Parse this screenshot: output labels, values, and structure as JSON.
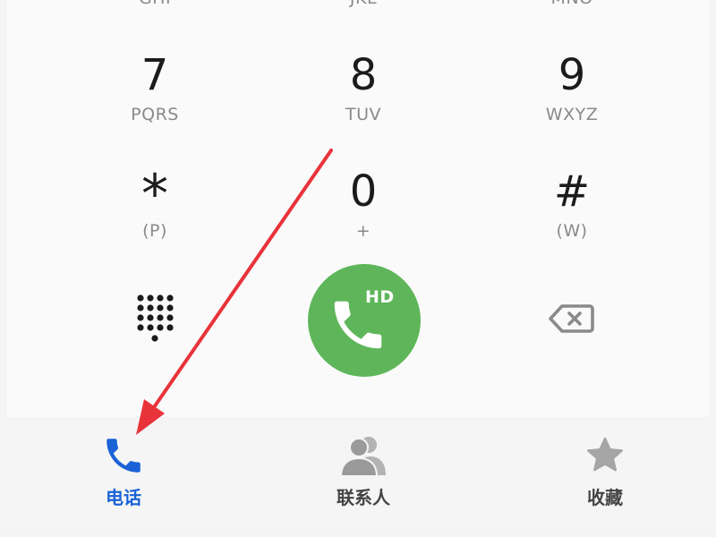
{
  "keypad": {
    "partial_row": [
      "GHI",
      "JKL",
      "MNO"
    ],
    "keys": [
      {
        "digit": "7",
        "sub": "PQRS"
      },
      {
        "digit": "8",
        "sub": "TUV"
      },
      {
        "digit": "9",
        "sub": "WXYZ"
      },
      {
        "digit": "*",
        "sub": "(P)"
      },
      {
        "digit": "0",
        "sub": "+"
      },
      {
        "digit": "#",
        "sub": "(W)"
      }
    ]
  },
  "actions": {
    "call_badge": "HD",
    "icons": [
      "dialpad-icon",
      "phone-icon",
      "backspace-icon"
    ]
  },
  "tabs": [
    {
      "label": "电话",
      "icon": "phone-icon",
      "active": true
    },
    {
      "label": "联系人",
      "icon": "contacts-icon",
      "active": false
    },
    {
      "label": "收藏",
      "icon": "star-icon",
      "active": false
    }
  ],
  "colors": {
    "accent": "#1a62d6",
    "call_green": "#5fb65a",
    "annotation_red": "#e8333a",
    "inactive_icon": "#9a9a9a",
    "inactive_text": "#444444"
  }
}
